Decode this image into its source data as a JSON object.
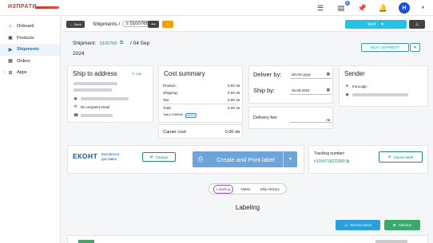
{
  "header": {
    "logo_text": "ИЗПРАТИ",
    "notifications_count": "5",
    "avatar_initial": "H"
  },
  "sidebar": {
    "items": [
      {
        "label": "Onboard",
        "icon": "store-icon"
      },
      {
        "label": "Products",
        "icon": "box-icon"
      },
      {
        "label": "Shipments",
        "icon": "truck-icon",
        "active": true
      },
      {
        "label": "Orders",
        "icon": "orders-icon"
      },
      {
        "label": "Apps",
        "icon": "apps-icon"
      }
    ]
  },
  "subbar": {
    "back_label": "Back",
    "crumb_title": "Shipments /",
    "shipment_id": "5100766",
    "dots": "•••",
    "l_tag": "L",
    "status_label": "Sent",
    "pin": "⊥"
  },
  "shipment": {
    "label": "Shipment:",
    "id_link": "5100766",
    "date_part": "/ 04 Sep",
    "year": "2024",
    "next_label": "NEXT SHIPMENT"
  },
  "ship_to": {
    "title": "Ship to address",
    "edit_label": "Edit",
    "email": "No recipient email"
  },
  "cost_summary": {
    "title": "Cost summary",
    "lines": [
      {
        "label": "Product:",
        "value": "0.00 лв"
      },
      {
        "label": "Shipping:",
        "value": "0.00 лв"
      },
      {
        "label": "Tax:",
        "value": "0.00 лв"
      }
    ],
    "total_label": "Total:",
    "total_value": "0.00 лв",
    "task_text": "Task # 2189345",
    "task_tag": "closed",
    "carrier_label": "Carrier cost:",
    "carrier_value": "0.00 лв"
  },
  "delivery": {
    "deliver_label": "Deliver by:",
    "deliver_placeholder": "dd.mm.yyyy",
    "ship_label": "Ship by:",
    "ship_value": "26.09.2024",
    "fee_label": "Delivery fee:",
    "fee_unit": "лв"
  },
  "sender": {
    "title": "Sender",
    "name": "IronLogic"
  },
  "carrier": {
    "logo": "ЕКОНТ",
    "sub": "Експресна доставка",
    "change_label": "Change",
    "print_label": "Create and Print label"
  },
  "tracking": {
    "label": "Tracking number:",
    "number": "#1054718222680",
    "cancel_label": "Cancel label"
  },
  "tabs": [
    {
      "label": "Labeling",
      "active": true
    },
    {
      "label": "Notes"
    },
    {
      "label": "Ship History"
    }
  ],
  "labeling": {
    "title": "Labeling",
    "box_sizes_label": "Set box sizes",
    "add_box_label": "Add box"
  }
}
